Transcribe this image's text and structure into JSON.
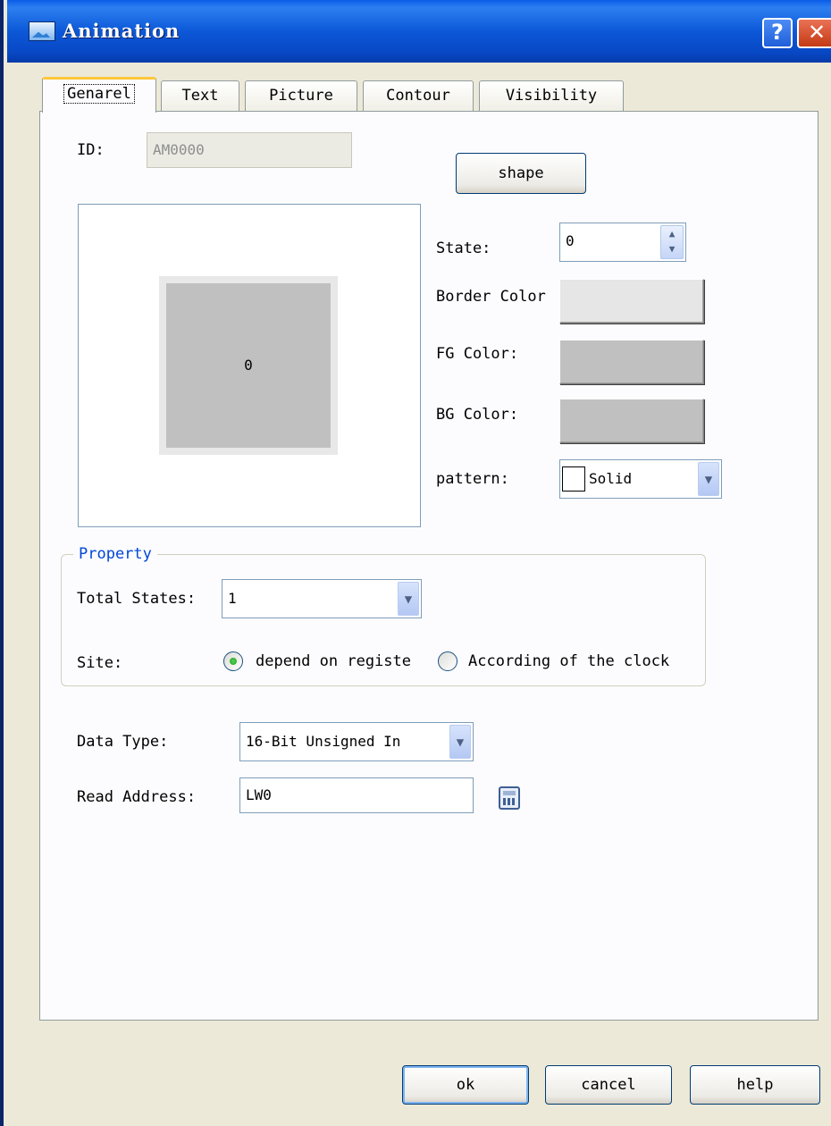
{
  "window": {
    "title": "Animation",
    "help_glyph": "?",
    "close_glyph": "✕"
  },
  "tabs": [
    {
      "label": "Genarel",
      "active": true
    },
    {
      "label": "Text",
      "active": false
    },
    {
      "label": "Picture",
      "active": false
    },
    {
      "label": "Contour",
      "active": false
    },
    {
      "label": "Visibility",
      "active": false
    }
  ],
  "general": {
    "id_label": "ID:",
    "id_value": "AM0000",
    "shape_button": "shape",
    "preview_state_text": "0",
    "state_label": "State:",
    "state_value": "0",
    "border_color_label": "Border Color",
    "fg_color_label": "FG Color:",
    "bg_color_label": "BG Color:",
    "pattern_label": "pattern:",
    "pattern_value": "Solid",
    "colors": {
      "border": "#e6e6e6",
      "fg": "#c0c0c0",
      "bg": "#c0c0c0"
    }
  },
  "property": {
    "title": "Property",
    "total_states_label": "Total States:",
    "total_states_value": "1",
    "site_label": "Site:",
    "site_options": [
      {
        "label": "depend on registe",
        "checked": true
      },
      {
        "label": "According of the clock",
        "checked": false
      }
    ]
  },
  "data_type_label": "Data Type:",
  "data_type_value": "16-Bit Unsigned In",
  "read_address_label": "Read Address:",
  "read_address_value": "LW0",
  "buttons": {
    "ok": "ok",
    "cancel": "cancel",
    "help": "help"
  }
}
